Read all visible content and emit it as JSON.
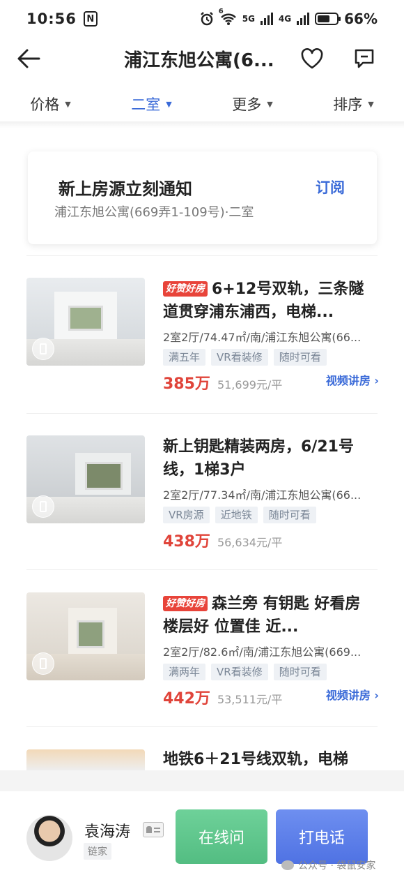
{
  "status_bar": {
    "time": "10:56",
    "nfc": "N",
    "network": "5G",
    "network2": "4G",
    "wifi_badge": "6",
    "battery_pct": "66%",
    "battery_level": 0.66
  },
  "header": {
    "title": "浦江东旭公寓(6..."
  },
  "filters": [
    {
      "label": "价格",
      "active": false
    },
    {
      "label": "二室",
      "active": true
    },
    {
      "label": "更多",
      "active": false
    },
    {
      "label": "排序",
      "active": false
    }
  ],
  "subscribe": {
    "title": "新上房源立刻通知",
    "button": "订阅",
    "description": "浦江东旭公寓(669弄1-109号)·二室"
  },
  "listings": [
    {
      "badge": "好赞好房",
      "title": "6+12号双轨，三条隧道贯穿浦东浦西，电梯...",
      "meta": "2室2厅/74.47㎡/南/浦江东旭公寓(66...",
      "tags": [
        "满五年",
        "VR看装修",
        "随时可看"
      ],
      "price": "385万",
      "unit_price": "51,699元/平",
      "video": "视频讲房"
    },
    {
      "badge": "",
      "title": "新上钥匙精装两房，6/21号线，1梯3户",
      "meta": "2室2厅/77.34㎡/南/浦江东旭公寓(66...",
      "tags": [
        "VR房源",
        "近地铁",
        "随时可看"
      ],
      "price": "438万",
      "unit_price": "56,634元/平",
      "video": ""
    },
    {
      "badge": "好赞好房",
      "title": "森兰旁  有钥匙  好看房  楼层好  位置佳  近...",
      "meta": "2室2厅/82.6㎡/南/浦江东旭公寓(669...",
      "tags": [
        "满两年",
        "VR看装修",
        "随时可看"
      ],
      "price": "442万",
      "unit_price": "53,511元/平",
      "video": "视频讲房"
    }
  ],
  "partial_listing": {
    "title": "地铁6＋21号线双轨，电梯"
  },
  "agent": {
    "name": "袁海涛",
    "company": "链家",
    "online_button": "在线问",
    "call_button": "打电话"
  },
  "watermark": "公众号 · 袋鼠安家",
  "colors": {
    "accent": "#3a6ad8",
    "price": "#e0443a",
    "online": "#5cc48a",
    "call": "#5a7ee8"
  }
}
